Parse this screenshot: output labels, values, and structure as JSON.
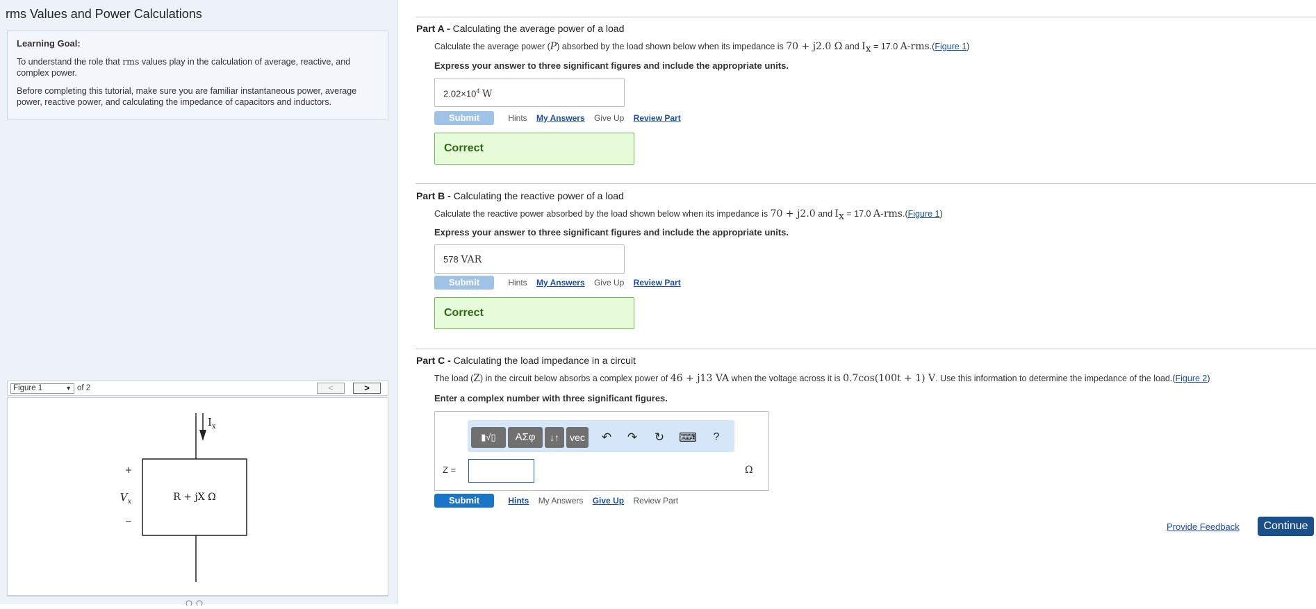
{
  "page_title": "rms Values and Power Calculations",
  "learning_goal": {
    "heading": "Learning Goal:",
    "p1a": "To understand the role that ",
    "p1_rms": "rms",
    "p1b": " values play in the calculation of average, reactive, and complex power.",
    "p2": "Before completing this tutorial, make sure you are familiar instantaneous power, average power, reactive power, and calculating the impedance of capacitors and inductors."
  },
  "figure_nav": {
    "selected": "Figure 1",
    "of_text": "of 2",
    "prev": "<",
    "next": ">"
  },
  "figure": {
    "current_label": "I",
    "current_sub": "x",
    "plus": "+",
    "minus": "−",
    "voltage_label": "V",
    "voltage_sub": "x",
    "impedance": "R + jX Ω"
  },
  "part_a": {
    "label": "Part A - ",
    "title": "Calculating the average power of a load",
    "q_1": "Calculate the average power (",
    "q_P": "P",
    "q_2": ") absorbed by the load shown below when its impedance is ",
    "q_imp": "70 + j2.0 Ω",
    "q_3": " and ",
    "q_I": "I",
    "q_Isub": "x",
    "q_4": " = 17.0 ",
    "q_unit": "A-rms",
    "q_5": ".(",
    "figure_link": "Figure 1",
    "q_6": ")",
    "instruction": "Express your answer to three significant figures and include the appropriate units.",
    "answer_value": "2.02×10",
    "answer_exp": "4",
    "answer_unit": "W",
    "submit": "Submit",
    "hints": "Hints",
    "my_answers": "My Answers",
    "give_up": "Give Up",
    "review_part": "Review Part",
    "result": "Correct"
  },
  "part_b": {
    "label": "Part B - ",
    "title": "Calculating the reactive power of a load",
    "q_1": "Calculate the reactive power absorbed by the load shown below when its impedance is ",
    "q_imp": "70 + j2.0",
    "q_2": " and ",
    "q_I": "I",
    "q_Isub": "x",
    "q_3": " = 17.0 ",
    "q_unit": "A-rms",
    "q_4": ".(",
    "figure_link": "Figure 1",
    "q_5": ")",
    "instruction": "Express your answer to three significant figures and include the appropriate units.",
    "answer_value": "578",
    "answer_unit": "VAR",
    "submit": "Submit",
    "hints": "Hints",
    "my_answers": "My Answers",
    "give_up": "Give Up",
    "review_part": "Review Part",
    "result": "Correct"
  },
  "part_c": {
    "label": "Part C - ",
    "title": "Calculating the load impedance in a circuit",
    "q_1": "The load (",
    "q_Z": "Z",
    "q_2": ") in the circuit below absorbs a complex power of ",
    "q_S": "46 + j13 VA",
    "q_3": " when the voltage across it is ",
    "q_V": "0.7cos(100t + 1) V",
    "q_4": ". Use this information to determine the impedance of the load.(",
    "figure_link": "Figure 2",
    "q_5": ")",
    "instruction": "Enter a complex number with three significant figures.",
    "toolbar": {
      "templates": "▮√▯",
      "greek": "ΑΣφ",
      "arrows": "↓↑",
      "vec": "vec",
      "undo": "↶",
      "redo": "↷",
      "reset": "↻",
      "keyboard": "⌨",
      "help": "?"
    },
    "z_label": "Z =",
    "z_value": "",
    "unit": "Ω",
    "submit": "Submit",
    "hints": "Hints",
    "my_answers": "My Answers",
    "give_up": "Give Up",
    "review_part": "Review Part"
  },
  "footer": {
    "feedback": "Provide Feedback",
    "continue": "Continue"
  },
  "colors": {
    "link": "#1a4f9c",
    "submit_active": "#1a75c9",
    "submit_disabled": "#9ec3e6",
    "correct_bg": "#e6fbd9",
    "correct_border": "#6cc04a",
    "continue_bg": "#1a4f8a",
    "left_panel_bg": "#edf2f9"
  }
}
